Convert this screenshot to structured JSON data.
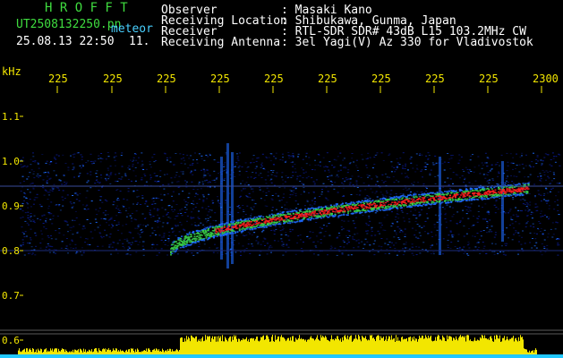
{
  "header": {
    "app_title": "H R O F F T",
    "filename": "UT2508132250.pn",
    "tag": "meteor",
    "datetime": "25.08.13 22:50",
    "index": "11.",
    "info_labels": [
      "Observer",
      "Receiving Location",
      "Receiver",
      "Receiving Antenna"
    ],
    "info_values": [
      ": Masaki Kano",
      ": Shibukawa, Gunma, Japan",
      ": RTL-SDR SDR# 43dB L15 103.2MHz CW",
      ": 3el Yagi(V) Az 330 for Vladivostok"
    ]
  },
  "chart_data": {
    "type": "heatmap",
    "title": "",
    "ylabel": "kHz",
    "ylim": [
      0.6,
      1.2
    ],
    "yticks": [
      "1.1",
      "1.0",
      "0.9",
      "0.8",
      "0.7",
      "0.6"
    ],
    "xtick_labels": [
      "225",
      "225",
      "225",
      "225",
      "225",
      "225",
      "225",
      "225",
      "225",
      "2300"
    ],
    "x_range": [
      "22:50",
      "23:00"
    ],
    "echo_band_khz": [
      0.82,
      0.96
    ],
    "carrier_khz": 0.94,
    "colors": {
      "background": "#000000",
      "noise_low": "#0a1a8c",
      "noise_mid": "#1e6bff",
      "signal_mid": "#39d04a",
      "signal_high": "#ff2020",
      "axis_labels": "#f2e600",
      "title": "#3fdc3f"
    },
    "level_trace_color": "#f2e600",
    "level_floor_color": "#21c8ff"
  }
}
